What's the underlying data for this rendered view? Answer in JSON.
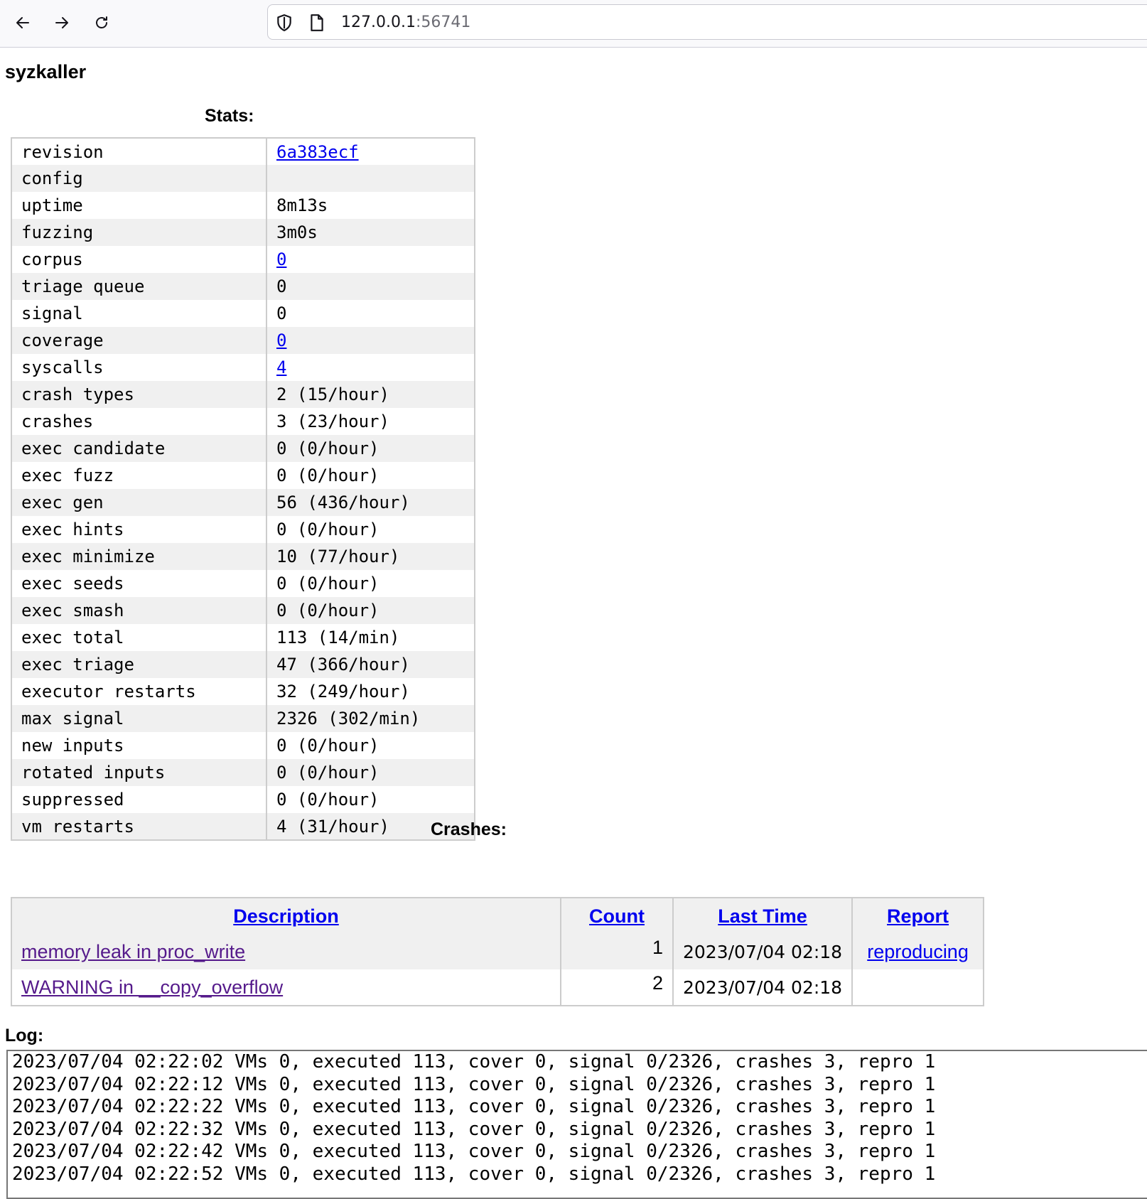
{
  "browser": {
    "url_host": "127.0.0.1",
    "url_port": ":56741"
  },
  "page": {
    "title": "syzkaller",
    "stats_caption": "Stats:",
    "crashes_caption": "Crashes:",
    "log_caption": "Log:"
  },
  "stats": [
    {
      "key": "revision",
      "value": "6a383ecf",
      "link": true
    },
    {
      "key": "config",
      "value": "",
      "link": false
    },
    {
      "key": "uptime",
      "value": "8m13s",
      "link": false
    },
    {
      "key": "fuzzing",
      "value": "3m0s",
      "link": false
    },
    {
      "key": "corpus",
      "value": "0",
      "link": true
    },
    {
      "key": "triage queue",
      "value": "0",
      "link": false
    },
    {
      "key": "signal",
      "value": "0",
      "link": false
    },
    {
      "key": "coverage",
      "value": "0",
      "link": true
    },
    {
      "key": "syscalls",
      "value": "4",
      "link": true
    },
    {
      "key": "crash types",
      "value": "2 (15/hour)",
      "link": false
    },
    {
      "key": "crashes",
      "value": "3 (23/hour)",
      "link": false
    },
    {
      "key": "exec candidate",
      "value": "0 (0/hour)",
      "link": false
    },
    {
      "key": "exec fuzz",
      "value": "0 (0/hour)",
      "link": false
    },
    {
      "key": "exec gen",
      "value": "56 (436/hour)",
      "link": false
    },
    {
      "key": "exec hints",
      "value": "0 (0/hour)",
      "link": false
    },
    {
      "key": "exec minimize",
      "value": "10 (77/hour)",
      "link": false
    },
    {
      "key": "exec seeds",
      "value": "0 (0/hour)",
      "link": false
    },
    {
      "key": "exec smash",
      "value": "0 (0/hour)",
      "link": false
    },
    {
      "key": "exec total",
      "value": "113 (14/min)",
      "link": false
    },
    {
      "key": "exec triage",
      "value": "47 (366/hour)",
      "link": false
    },
    {
      "key": "executor restarts",
      "value": "32 (249/hour)",
      "link": false
    },
    {
      "key": "max signal",
      "value": "2326 (302/min)",
      "link": false
    },
    {
      "key": "new inputs",
      "value": "0 (0/hour)",
      "link": false
    },
    {
      "key": "rotated inputs",
      "value": "0 (0/hour)",
      "link": false
    },
    {
      "key": "suppressed",
      "value": "0 (0/hour)",
      "link": false
    },
    {
      "key": "vm restarts",
      "value": "4 (31/hour)",
      "link": false
    }
  ],
  "crashes": {
    "headers": {
      "description": "Description",
      "count": "Count",
      "last_time": "Last Time",
      "report": "Report"
    },
    "rows": [
      {
        "description": "memory leak in proc_write",
        "count": "1",
        "last_time": "2023/07/04 02:18",
        "report": "reproducing"
      },
      {
        "description": "WARNING in __copy_overflow",
        "count": "2",
        "last_time": "2023/07/04 02:18",
        "report": ""
      }
    ]
  },
  "log": [
    "2023/07/04 02:22:02 VMs 0, executed 113, cover 0, signal 0/2326, crashes 3, repro 1",
    "2023/07/04 02:22:12 VMs 0, executed 113, cover 0, signal 0/2326, crashes 3, repro 1",
    "2023/07/04 02:22:22 VMs 0, executed 113, cover 0, signal 0/2326, crashes 3, repro 1",
    "2023/07/04 02:22:32 VMs 0, executed 113, cover 0, signal 0/2326, crashes 3, repro 1",
    "2023/07/04 02:22:42 VMs 0, executed 113, cover 0, signal 0/2326, crashes 3, repro 1",
    "2023/07/04 02:22:52 VMs 0, executed 113, cover 0, signal 0/2326, crashes 3, repro 1"
  ],
  "icons": {
    "back": "back-arrow-icon",
    "forward": "forward-arrow-icon",
    "reload": "reload-icon",
    "shield": "shield-icon",
    "page": "page-icon"
  },
  "colors": {
    "link": "#0000ee",
    "visited_link": "#551a8b",
    "row_stripe": "#f0f0f0",
    "border": "#cccccc"
  }
}
